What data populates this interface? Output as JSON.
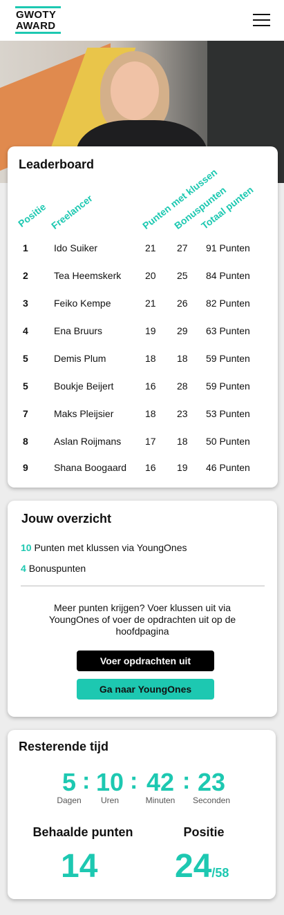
{
  "header": {
    "logo_line1": "GWOTY",
    "logo_line2": "AWARD"
  },
  "leaderboard": {
    "title": "Leaderboard",
    "columns": [
      "Positie",
      "Freelancer",
      "Punten met klussen",
      "Bonuspunten",
      "Totaal punten"
    ],
    "rows": [
      {
        "pos": "1",
        "name": "Ido Suiker",
        "klus": "21",
        "bonus": "27",
        "total": "91 Punten"
      },
      {
        "pos": "2",
        "name": "Tea Heemskerk",
        "klus": "20",
        "bonus": "25",
        "total": "84 Punten"
      },
      {
        "pos": "3",
        "name": "Feiko Kempe",
        "klus": "21",
        "bonus": "26",
        "total": "82 Punten"
      },
      {
        "pos": "4",
        "name": "Ena Bruurs",
        "klus": "19",
        "bonus": "29",
        "total": "63 Punten"
      },
      {
        "pos": "5",
        "name": "Demis Plum",
        "klus": "18",
        "bonus": "18",
        "total": "59 Punten"
      },
      {
        "pos": "5",
        "name": "Boukje Beijert",
        "klus": "16",
        "bonus": "28",
        "total": "59 Punten"
      },
      {
        "pos": "7",
        "name": "Maks Pleijsier",
        "klus": "18",
        "bonus": "23",
        "total": "53 Punten"
      },
      {
        "pos": "8",
        "name": "Aslan Roijmans",
        "klus": "17",
        "bonus": "18",
        "total": "50 Punten"
      },
      {
        "pos": "9",
        "name": "Shana Boogaard",
        "klus": "16",
        "bonus": "19",
        "total": "46 Punten"
      }
    ]
  },
  "overzicht": {
    "title": "Jouw overzicht",
    "klus_points": "10",
    "klus_label": "Punten met klussen via YoungOnes",
    "bonus_points": "4",
    "bonus_label": "Bonuspunten",
    "info_text": "Meer punten krijgen? Voer klussen uit via YoungOnes of voer de opdrachten uit op de hoofdpagina",
    "btn_opdrachten": "Voer opdrachten uit",
    "btn_youngones": "Ga naar YoungOnes"
  },
  "tijd": {
    "title": "Resterende tijd",
    "days": "5",
    "hours": "10",
    "minutes": "42",
    "seconds": "23",
    "separator": ":",
    "days_label": "Dagen",
    "hours_label": "Uren",
    "minutes_label": "Minuten",
    "seconds_label": "Seconden",
    "points_label": "Behaalde punten",
    "points_value": "14",
    "position_label": "Positie",
    "position_value": "24",
    "position_total": "/58"
  },
  "colors": {
    "accent": "#1dc8b1",
    "dark": "#000000"
  },
  "icons": {
    "menu": "hamburger-menu-icon"
  }
}
